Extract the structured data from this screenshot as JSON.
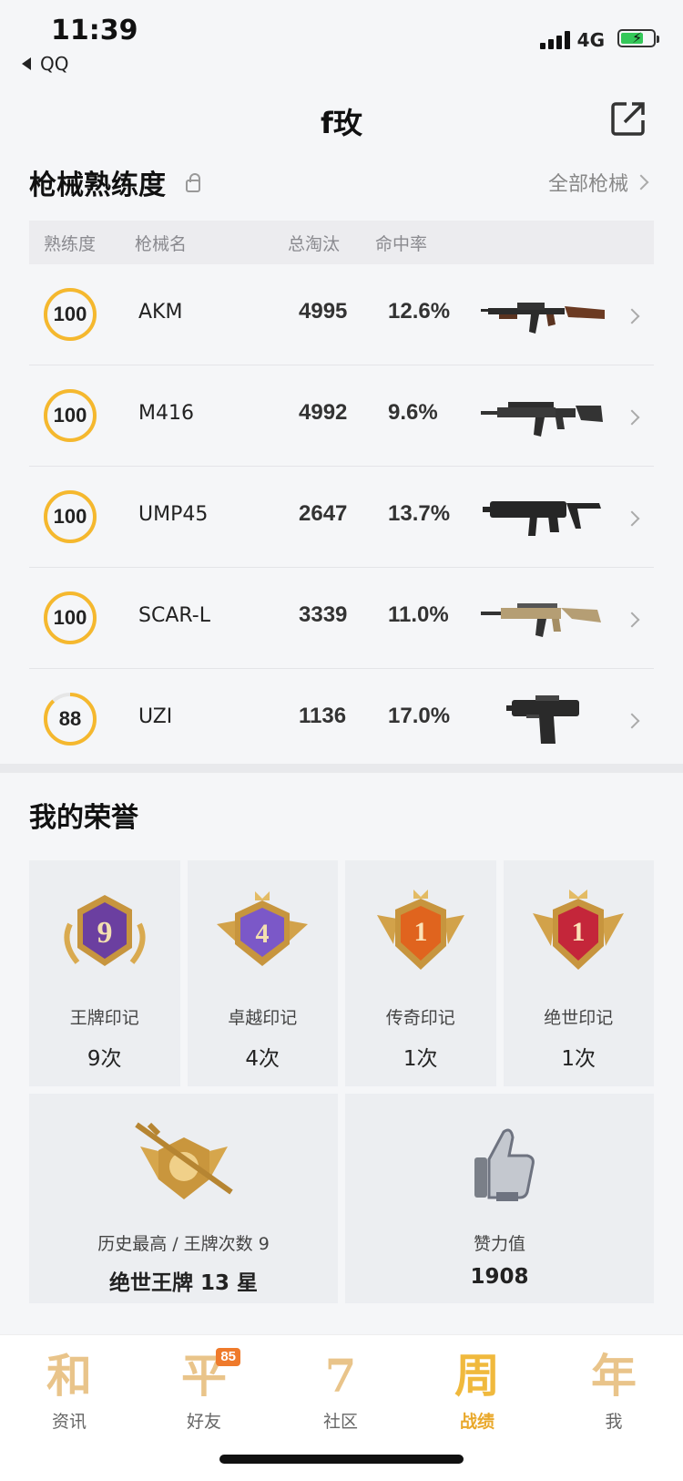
{
  "status_bar": {
    "time": "11:39",
    "back_label": "QQ",
    "network": "4G"
  },
  "header": {
    "title": "f玫"
  },
  "weapons": {
    "section_title": "枪械熟练度",
    "all_link": "全部枪械",
    "columns": [
      "熟练度",
      "枪械名",
      "总淘汰",
      "命中率"
    ],
    "rows": [
      {
        "proficiency": "100",
        "name": "AKM",
        "kills": "4995",
        "hit_rate": "12.6%",
        "image": "akm-rifle",
        "progress": 1.0
      },
      {
        "proficiency": "100",
        "name": "M416",
        "kills": "4992",
        "hit_rate": "9.6%",
        "image": "m416-rifle",
        "progress": 1.0
      },
      {
        "proficiency": "100",
        "name": "UMP45",
        "kills": "2647",
        "hit_rate": "13.7%",
        "image": "ump45-smg",
        "progress": 1.0
      },
      {
        "proficiency": "100",
        "name": "SCAR-L",
        "kills": "3339",
        "hit_rate": "11.0%",
        "image": "scarl-rifle",
        "progress": 1.0
      },
      {
        "proficiency": "88",
        "name": "UZI",
        "kills": "1136",
        "hit_rate": "17.0%",
        "image": "uzi-smg",
        "progress": 0.88
      }
    ]
  },
  "honors": {
    "section_title": "我的荣誉",
    "badges": [
      {
        "label": "王牌印记",
        "count": "9次",
        "number": "9",
        "color": "#6b3fa0"
      },
      {
        "label": "卓越印记",
        "count": "4次",
        "number": "4",
        "color": "#7b58c8"
      },
      {
        "label": "传奇印记",
        "count": "1次",
        "number": "1",
        "color": "#e0641e"
      },
      {
        "label": "绝世印记",
        "count": "1次",
        "number": "1",
        "color": "#c4263a"
      }
    ],
    "history": {
      "label": "历史最高 / 王牌次数 9",
      "value": "绝世王牌 13 星"
    },
    "likes": {
      "label": "赞力值",
      "value": "1908"
    }
  },
  "tabbar": {
    "tabs": [
      {
        "glyph": "和",
        "label": "资讯",
        "active": false
      },
      {
        "glyph": "平",
        "label": "好友",
        "active": false,
        "badge": "85"
      },
      {
        "glyph": "7",
        "label": "社区",
        "active": false
      },
      {
        "glyph": "周",
        "label": "战绩",
        "active": true
      },
      {
        "glyph": "年",
        "label": "我",
        "active": false
      }
    ]
  },
  "colors": {
    "accent": "#f5b82e",
    "ring_bg": "#e6e6e6",
    "tab_active": "#e9a82b"
  }
}
